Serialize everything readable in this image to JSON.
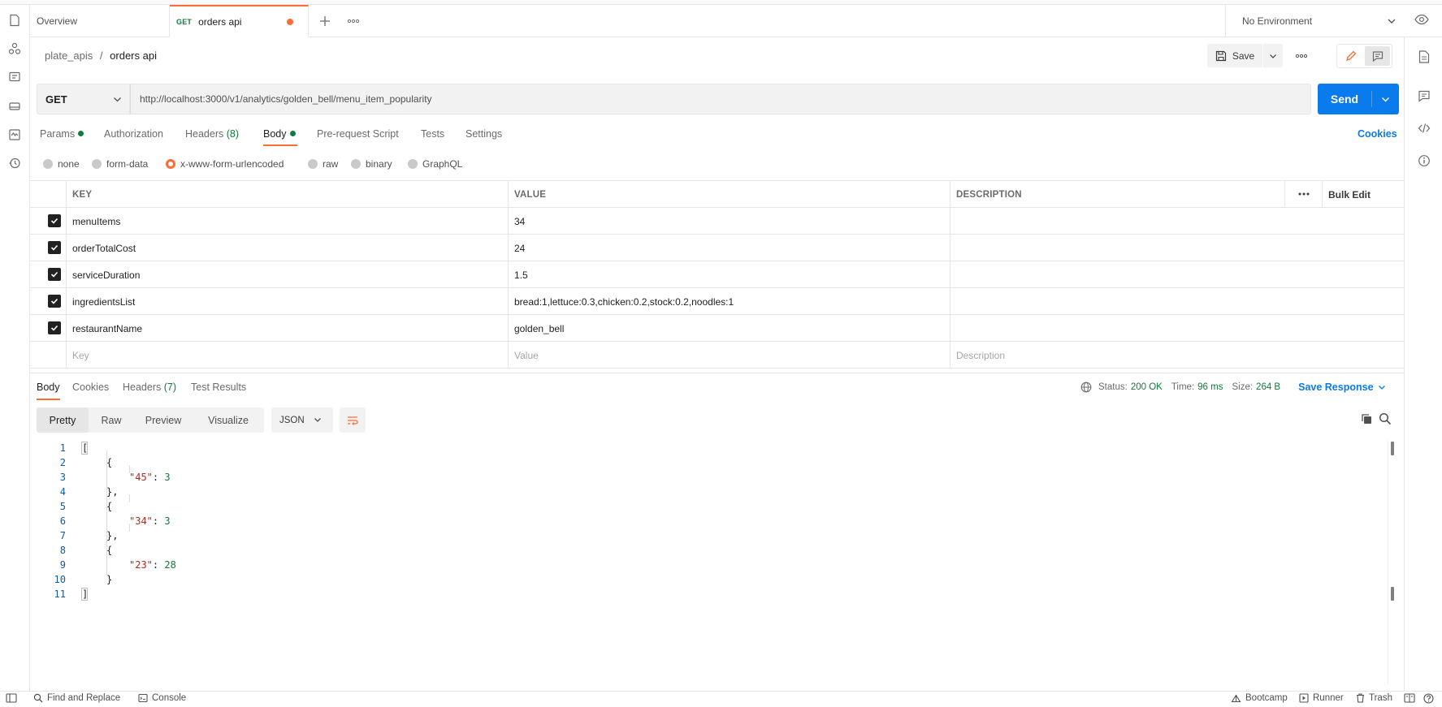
{
  "tabs": {
    "overview": "Overview",
    "active_method": "GET",
    "active_label": "orders api"
  },
  "environment": {
    "selected": "No Environment"
  },
  "breadcrumb": {
    "collection": "plate_apis",
    "separator": "/",
    "request": "orders api"
  },
  "header": {
    "save_label": "Save"
  },
  "request": {
    "method": "GET",
    "url": "http://localhost:3000/v1/analytics/golden_bell/menu_item_popularity",
    "send_label": "Send",
    "cookies_label": "Cookies"
  },
  "request_tabs": {
    "params": "Params",
    "authorization": "Authorization",
    "headers": "Headers",
    "headers_count": "(8)",
    "body": "Body",
    "pre_request": "Pre-request Script",
    "tests": "Tests",
    "settings": "Settings"
  },
  "body_types": {
    "none": "none",
    "form_data": "form-data",
    "urlencoded": "x-www-form-urlencoded",
    "raw": "raw",
    "binary": "binary",
    "graphql": "GraphQL",
    "selected": "x-www-form-urlencoded"
  },
  "params_table": {
    "headers": {
      "key": "KEY",
      "value": "VALUE",
      "description": "DESCRIPTION",
      "bulk_edit": "Bulk Edit"
    },
    "rows": [
      {
        "key": "menuItems",
        "value": "34",
        "checked": true
      },
      {
        "key": "orderTotalCost",
        "value": "24",
        "checked": true
      },
      {
        "key": "serviceDuration",
        "value": "1.5",
        "checked": true
      },
      {
        "key": "ingredientsList",
        "value": "bread:1,lettuce:0.3,chicken:0.2,stock:0.2,noodles:1",
        "checked": true
      },
      {
        "key": "restaurantName",
        "value": "golden_bell",
        "checked": true
      }
    ],
    "placeholder": {
      "key": "Key",
      "value": "Value",
      "description": "Description"
    }
  },
  "response": {
    "tabs": {
      "body": "Body",
      "cookies": "Cookies",
      "headers": "Headers",
      "headers_count": "(7)",
      "test_results": "Test Results"
    },
    "status_label": "Status:",
    "status_value": "200 OK",
    "time_label": "Time:",
    "time_value": "96 ms",
    "size_label": "Size:",
    "size_value": "264 B",
    "save_response": "Save Response",
    "view_modes": {
      "pretty": "Pretty",
      "raw": "Raw",
      "preview": "Preview",
      "visualize": "Visualize"
    },
    "format": "JSON",
    "code_lines": [
      {
        "n": "1",
        "text": "["
      },
      {
        "n": "2",
        "text": "{"
      },
      {
        "n": "3",
        "key": "\"45\"",
        "value": "3"
      },
      {
        "n": "4",
        "text": "},"
      },
      {
        "n": "5",
        "text": "{"
      },
      {
        "n": "6",
        "key": "\"34\"",
        "value": "3"
      },
      {
        "n": "7",
        "text": "},"
      },
      {
        "n": "8",
        "text": "{"
      },
      {
        "n": "9",
        "key": "\"23\"",
        "value": "28"
      },
      {
        "n": "10",
        "text": "}"
      },
      {
        "n": "11",
        "text": "]"
      }
    ]
  },
  "footer": {
    "find_replace": "Find and Replace",
    "console": "Console",
    "bootcamp": "Bootcamp",
    "runner": "Runner",
    "trash": "Trash"
  },
  "colors": {
    "accent": "#ff6c37",
    "primary": "#097bed",
    "success": "#0f7b3c"
  }
}
